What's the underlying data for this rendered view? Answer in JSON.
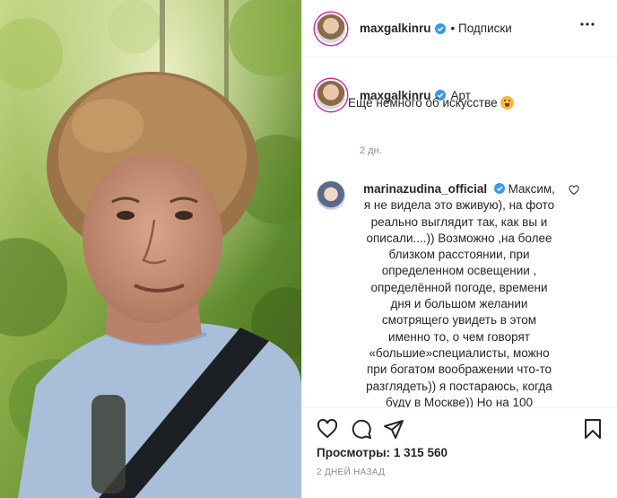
{
  "post": {
    "author": "maxgalkinru",
    "follow_status": "• Подписки",
    "caption_tag": "Арт",
    "caption_text": "Ещё немного об искусстве",
    "caption_time": "2 дн.",
    "views_label": "Просмотры:",
    "views_count": "1 315 560",
    "date": "2 ДНЕЙ НАЗАД"
  },
  "comment": {
    "author": "marinazudina_official",
    "text": "Максим, я не видела это вживую), на фото реально выглядит так, как вы и описали....)) Возможно ,на более близком расстоянии, при определенном освещении , определённой погоде, времени дня и большом желании смотрящего увидеть в этом именно то, о чем говорят «большие»специалисты, можно при богатом воображении что-то разглядеть)) я постараюсь, когда буду в Москве)) Но на 100"
  },
  "colors": {
    "verified": "#3897f0",
    "ring": "#d6249f",
    "text": "#262626",
    "secondary": "#8e8e8e"
  },
  "icons": [
    "more-icon",
    "verified-icon",
    "heart-icon",
    "comment-icon",
    "share-icon",
    "bookmark-icon",
    "smile-emoji-icon"
  ]
}
